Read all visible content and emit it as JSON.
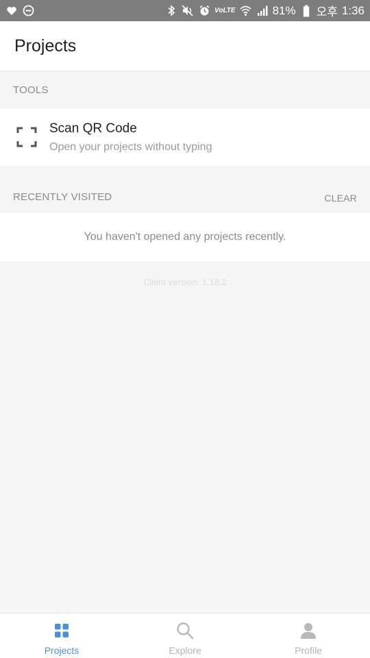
{
  "status_bar": {
    "battery_percent": "81%",
    "time_period": "오후",
    "time": "1:36",
    "volte_label": "VoLTE",
    "left_icons": [
      "heart-icon",
      "do-not-disturb-icon"
    ],
    "right_icons": [
      "bluetooth-icon",
      "mute-icon",
      "alarm-icon",
      "volte-icon",
      "wifi-icon",
      "signal-icon",
      "battery-icon"
    ]
  },
  "header": {
    "title": "Projects"
  },
  "tools": {
    "section_label": "TOOLS",
    "items": [
      {
        "icon": "qr-scan-icon",
        "title": "Scan QR Code",
        "subtitle": "Open your projects without typing"
      }
    ]
  },
  "recently_visited": {
    "section_label": "RECENTLY VISITED",
    "clear_label": "CLEAR",
    "empty_message": "You haven't opened any projects recently."
  },
  "footer": {
    "client_version": "Client version: 1.18.2"
  },
  "bottom_nav": {
    "items": [
      {
        "label": "Projects",
        "icon": "grid-icon",
        "active": true
      },
      {
        "label": "Explore",
        "icon": "search-icon",
        "active": false
      },
      {
        "label": "Profile",
        "icon": "person-icon",
        "active": false
      }
    ]
  },
  "colors": {
    "accent": "#4a90d9",
    "status_bar": "#7d7d7d",
    "background": "#f5f5f5"
  }
}
